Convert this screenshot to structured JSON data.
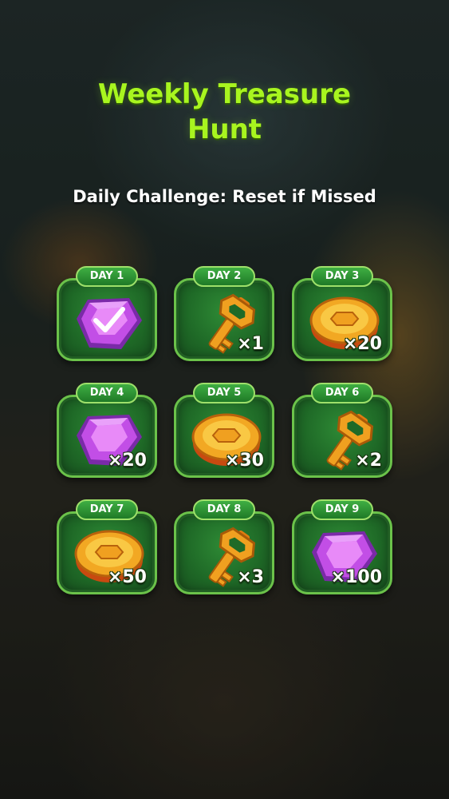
{
  "title_line1": "Weekly Treasure",
  "title_line2": "Hunt",
  "subtitle": "Daily Challenge: Reset if Missed",
  "colors": {
    "title": "#a8f51f",
    "card": "#1f6a27",
    "badge": "#3fae43"
  },
  "days": [
    {
      "label": "DAY 1",
      "item": "gem-icon",
      "qty": "",
      "claimed": true
    },
    {
      "label": "DAY 2",
      "item": "key-icon",
      "qty": "×1",
      "claimed": false
    },
    {
      "label": "DAY 3",
      "item": "coin-icon",
      "qty": "×20",
      "claimed": false
    },
    {
      "label": "DAY 4",
      "item": "gem-icon",
      "qty": "×20",
      "claimed": false
    },
    {
      "label": "DAY 5",
      "item": "coin-icon",
      "qty": "×30",
      "claimed": false
    },
    {
      "label": "DAY 6",
      "item": "key-icon",
      "qty": "×2",
      "claimed": false
    },
    {
      "label": "DAY 7",
      "item": "coin-icon",
      "qty": "×50",
      "claimed": false
    },
    {
      "label": "DAY 8",
      "item": "key-icon",
      "qty": "×3",
      "claimed": false
    },
    {
      "label": "DAY 9",
      "item": "gem-icon",
      "qty": "×100",
      "claimed": false
    }
  ]
}
